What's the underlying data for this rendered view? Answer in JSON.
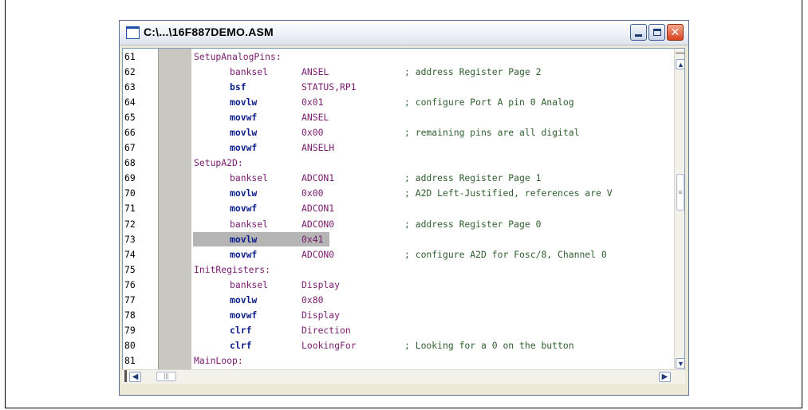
{
  "window": {
    "title": "C:\\...\\16F887DEMO.ASM"
  },
  "icons": [
    "document-icon",
    "minimize-icon",
    "maximize-icon",
    "close-icon",
    "scroll-up-icon",
    "scroll-down-icon",
    "scroll-left-icon",
    "scroll-right-icon",
    "grip-icon"
  ],
  "code": [
    {
      "ln": "61",
      "label": "SetupAnalogPins:",
      "op": "",
      "kw": false,
      "arg": "",
      "cmt": ""
    },
    {
      "ln": "62",
      "label": "",
      "op": "banksel",
      "kw": false,
      "arg": "ANSEL",
      "cmt": "; address Register Page 2"
    },
    {
      "ln": "63",
      "label": "",
      "op": "bsf",
      "kw": true,
      "arg": "STATUS,RP1",
      "cmt": ""
    },
    {
      "ln": "64",
      "label": "",
      "op": "movlw",
      "kw": true,
      "arg": "0x01",
      "cmt": "; configure Port A pin 0 Analog"
    },
    {
      "ln": "65",
      "label": "",
      "op": "movwf",
      "kw": true,
      "arg": "ANSEL",
      "cmt": ""
    },
    {
      "ln": "66",
      "label": "",
      "op": "movlw",
      "kw": true,
      "arg": "0x00",
      "cmt": "; remaining pins are all digital"
    },
    {
      "ln": "67",
      "label": "",
      "op": "movwf",
      "kw": true,
      "arg": "ANSELH",
      "cmt": ""
    },
    {
      "ln": "68",
      "label": "SetupA2D:",
      "op": "",
      "kw": false,
      "arg": "",
      "cmt": ""
    },
    {
      "ln": "69",
      "label": "",
      "op": "banksel",
      "kw": false,
      "arg": "ADCON1",
      "cmt": "; address Register Page 1"
    },
    {
      "ln": "70",
      "label": "",
      "op": "movlw",
      "kw": true,
      "arg": "0x00",
      "cmt": "; A2D Left-Justified, references are V"
    },
    {
      "ln": "71",
      "label": "",
      "op": "movwf",
      "kw": true,
      "arg": "ADCON1",
      "cmt": ""
    },
    {
      "ln": "72",
      "label": "",
      "op": "banksel",
      "kw": false,
      "arg": "ADCON0",
      "cmt": "; address Register Page 0"
    },
    {
      "ln": "73",
      "label": "",
      "op": "movlw",
      "kw": true,
      "arg": "0x41",
      "cmt": "",
      "highlight": true
    },
    {
      "ln": "74",
      "label": "",
      "op": "movwf",
      "kw": true,
      "arg": "ADCON0",
      "cmt": "; configure A2D for Fosc/8, Channel 0"
    },
    {
      "ln": "75",
      "label": "InitRegisters:",
      "op": "",
      "kw": false,
      "arg": "",
      "cmt": ""
    },
    {
      "ln": "76",
      "label": "",
      "op": "banksel",
      "kw": false,
      "arg": "Display",
      "cmt": ""
    },
    {
      "ln": "77",
      "label": "",
      "op": "movlw",
      "kw": true,
      "arg": "0x80",
      "cmt": ""
    },
    {
      "ln": "78",
      "label": "",
      "op": "movwf",
      "kw": true,
      "arg": "Display",
      "cmt": ""
    },
    {
      "ln": "79",
      "label": "",
      "op": "clrf",
      "kw": true,
      "arg": "Direction",
      "cmt": ""
    },
    {
      "ln": "80",
      "label": "",
      "op": "clrf",
      "kw": true,
      "arg": "LookingFor",
      "cmt": "; Looking for a 0 on the button"
    },
    {
      "ln": "81",
      "label": "MainLoop:",
      "op": "",
      "kw": false,
      "arg": "",
      "cmt": ""
    }
  ]
}
